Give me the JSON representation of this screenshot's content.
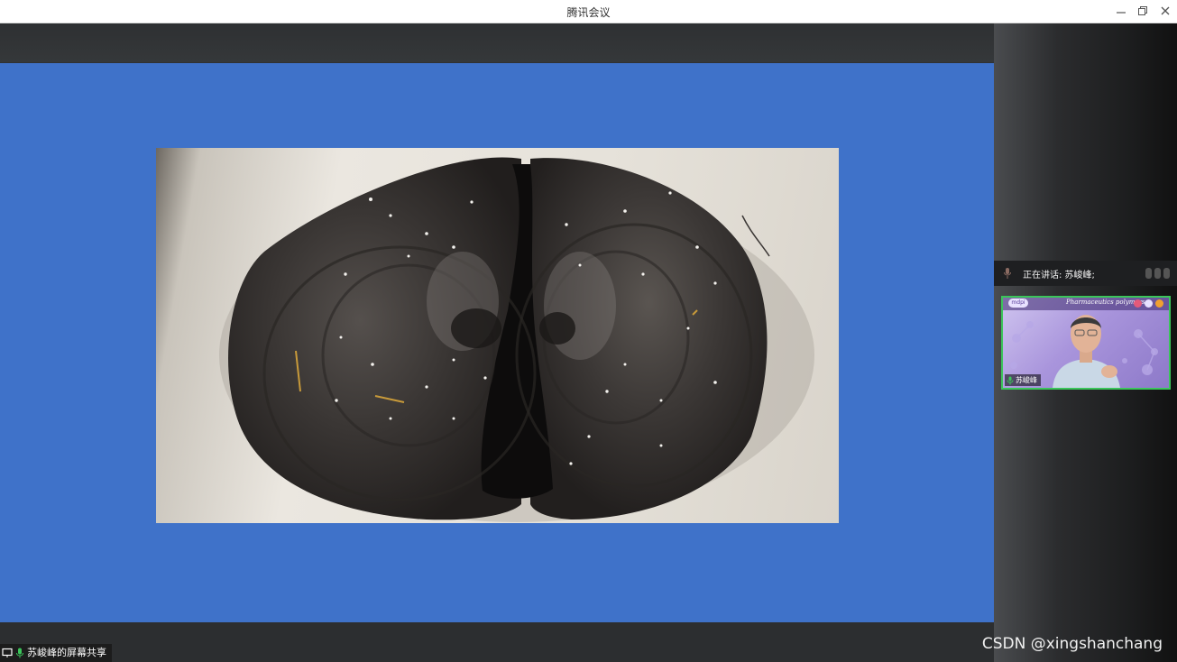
{
  "window": {
    "title": "腾讯会议",
    "controls": [
      "minimize-icon",
      "restore-icon",
      "close-icon"
    ]
  },
  "share": {
    "label": "苏峻峰的屏幕共享"
  },
  "speaker_bar": {
    "text": "正在讲话: 苏峻峰;"
  },
  "participant": {
    "name": "苏峻峰",
    "journal_text": "Pharmaceutics polymers"
  },
  "watermark": "CSDN @xingshanchang",
  "colors": {
    "slide_bg": "#3f72c9",
    "speaker_border": "#3bc55a",
    "titlebar_bg": "#ffffff"
  }
}
